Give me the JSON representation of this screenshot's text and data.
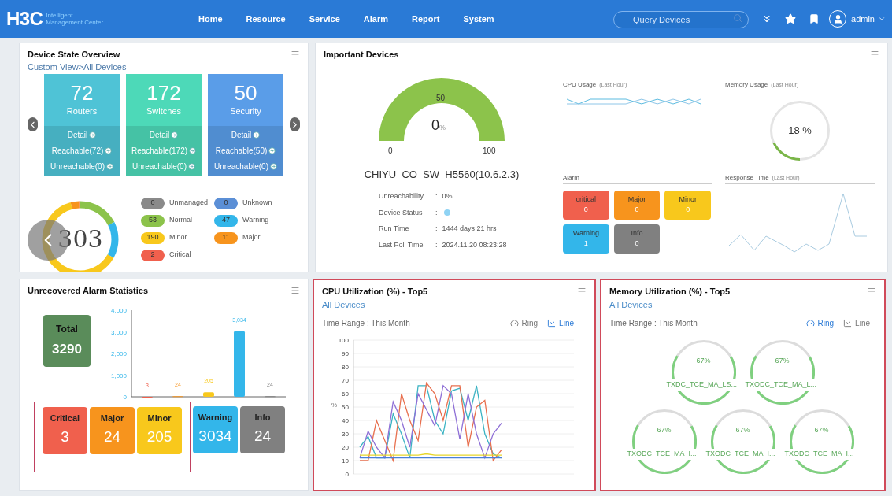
{
  "header": {
    "logo": "H3C",
    "logo_sub": [
      "Intelligent",
      "Management Center"
    ],
    "nav": [
      {
        "label": "Home"
      },
      {
        "label": "Resource"
      },
      {
        "label": "Service"
      },
      {
        "label": "Alarm"
      },
      {
        "label": "Report"
      },
      {
        "label": "System"
      }
    ],
    "search": {
      "placeholder": "Query Devices"
    },
    "user": "admin"
  },
  "device_state": {
    "title": "Device State Overview",
    "view_link": "Custom View>All Devices",
    "cards": [
      {
        "count": "72",
        "label": "Routers",
        "color": "#4fc3d6",
        "links": [
          "Detail",
          "Reachable(72)",
          "Unreachable(0)"
        ]
      },
      {
        "count": "172",
        "label": "Switches",
        "color": "#4dd9b8",
        "links": [
          "Detail",
          "Reachable(172)",
          "Unreachable(0)"
        ]
      },
      {
        "count": "50",
        "label": "Security",
        "color": "#5a9de8",
        "links": [
          "Detail",
          "Reachable(50)",
          "Unreachable(0)"
        ]
      }
    ],
    "total": "303",
    "legend": [
      {
        "count": "0",
        "label": "Unmanaged",
        "color": "#8a8a8a"
      },
      {
        "count": "0",
        "label": "Unknown",
        "color": "#5b8fd6"
      },
      {
        "count": "53",
        "label": "Normal",
        "color": "#8cc34b"
      },
      {
        "count": "47",
        "label": "Warning",
        "color": "#33b6ea"
      },
      {
        "count": "190",
        "label": "Minor",
        "color": "#f8c81c"
      },
      {
        "count": "11",
        "label": "Major",
        "color": "#f7941d"
      },
      {
        "count": "2",
        "label": "Critical",
        "color": "#f0604d"
      }
    ]
  },
  "important_devices": {
    "title": "Important Devices",
    "gauge": {
      "value": "0",
      "unit": "%",
      "ticks": [
        "0",
        "50",
        "100"
      ]
    },
    "device_name": "CHIYU_CO_SW_H5560(10.6.2.3)",
    "info": [
      {
        "kind": "text",
        "label": "Unreachability",
        "separator": ":",
        "value": "0%"
      },
      {
        "kind": "dot",
        "label": "Device Status",
        "separator": ":",
        "color": "#8fd3f4"
      },
      {
        "kind": "text",
        "label": "Run Time",
        "separator": ":",
        "value": "1444 days 21 hrs"
      },
      {
        "kind": "text",
        "label": "Last Poll Time",
        "separator": ":",
        "value": "2024.11.20 08:23:28"
      }
    ],
    "cpu_usage": {
      "title": "CPU Usage",
      "note": "(Last Hour)"
    },
    "memory_usage": {
      "title": "Memory Usage",
      "note": "(Last Hour)",
      "level": 0.18,
      "reading": "18 %"
    },
    "alarm": {
      "title": "Alarm",
      "tiles": [
        {
          "label": "critical",
          "count": "0",
          "color": "#f0604d"
        },
        {
          "label": "Major",
          "count": "0",
          "color": "#f7941d"
        },
        {
          "label": "Minor",
          "count": "0",
          "color": "#f8c81c"
        },
        {
          "label": "Warning",
          "count": "1",
          "color": "#33b6ea"
        },
        {
          "label": "Info",
          "count": "0",
          "color": "#808080"
        }
      ]
    },
    "response_time": {
      "title": "Response Time",
      "note": "(Last Hour)"
    }
  },
  "alarm_statistics": {
    "title": "Unrecovered Alarm Statistics",
    "total_label": "Total",
    "total": "3290",
    "chart_data": {
      "type": "bar",
      "values": [
        3,
        24,
        205,
        3034,
        24
      ],
      "ylim": [
        0,
        4000
      ],
      "yticks": [
        {
          "value": 0,
          "label": "0"
        },
        {
          "value": 1000,
          "label": "1,000"
        },
        {
          "value": 2000,
          "label": "2,000"
        },
        {
          "value": 3000,
          "label": "3,000"
        },
        {
          "value": 4000,
          "label": "4,000"
        }
      ],
      "value_labels": [
        "3",
        "24",
        "205",
        "3,034",
        "24"
      ]
    },
    "tiles": [
      {
        "label": "Critical",
        "count": "3",
        "color": "#f0604d",
        "highlighted": true
      },
      {
        "label": "Major",
        "count": "24",
        "color": "#f7941d",
        "highlighted": true
      },
      {
        "label": "Minor",
        "count": "205",
        "color": "#f8c81c",
        "highlighted": true
      },
      {
        "label": "Warning",
        "count": "3034",
        "color": "#33b6ea",
        "highlighted": false
      },
      {
        "label": "Info",
        "count": "24",
        "color": "#808080",
        "highlighted": false
      }
    ]
  },
  "cpu_top5": {
    "title": "CPU Utilization (%) - Top5",
    "link": "All Devices",
    "time_range": "Time Range : This Month",
    "highlighted": true,
    "views": [
      {
        "label": "Ring",
        "selected": false
      },
      {
        "label": "Line",
        "selected": true
      }
    ],
    "chart_data": {
      "type": "line",
      "ylabel": "%",
      "ylim": [
        0,
        100
      ],
      "grid": true,
      "yticks": [
        0,
        10,
        20,
        30,
        40,
        50,
        60,
        70,
        80,
        90,
        100
      ],
      "series": [
        {
          "color": "#3bb3c3",
          "values": [
            20,
            28,
            12,
            12,
            45,
            30,
            12,
            66,
            66,
            40,
            30,
            62,
            64,
            40,
            66,
            30,
            15,
            12
          ]
        },
        {
          "color": "#e8704f",
          "values": [
            10,
            10,
            40,
            25,
            10,
            60,
            40,
            25,
            68,
            60,
            40,
            66,
            66,
            20,
            50,
            55,
            10,
            18
          ]
        },
        {
          "color": "#8e6fd6",
          "values": [
            12,
            32,
            20,
            12,
            54,
            40,
            20,
            60,
            48,
            36,
            66,
            60,
            26,
            60,
            30,
            12,
            30,
            38
          ]
        },
        {
          "color": "#e6d62a",
          "values": [
            14,
            14,
            14,
            14,
            14,
            14,
            14,
            14,
            15,
            14,
            14,
            14,
            14,
            14,
            14,
            14,
            14,
            14
          ]
        },
        {
          "color": "#4a7fd8",
          "values": [
            12,
            12,
            12,
            12,
            12,
            12,
            12,
            12,
            12,
            12,
            12,
            12,
            12,
            12,
            12,
            12,
            12,
            12
          ]
        }
      ]
    }
  },
  "memory_top5": {
    "title": "Memory Utilization (%) - Top5",
    "link": "All Devices",
    "time_range": "Time Range : This Month",
    "highlighted": true,
    "views": [
      {
        "label": "Ring",
        "selected": true
      },
      {
        "label": "Line",
        "selected": false
      }
    ],
    "rings": [
      {
        "reading": "67%",
        "name": "TXDC_TCE_MA_LS...",
        "level": 0.67
      },
      {
        "reading": "67%",
        "name": "TXODC_TCE_MA_L...",
        "level": 0.67
      },
      {
        "reading": "67%",
        "name": "TXODC_TCE_MA_I...",
        "level": 0.67
      },
      {
        "reading": "67%",
        "name": "TXODC_TCE_MA_I...",
        "level": 0.67
      },
      {
        "reading": "67%",
        "name": "TXODC_TCE_MA_I...",
        "level": 0.67
      }
    ]
  }
}
